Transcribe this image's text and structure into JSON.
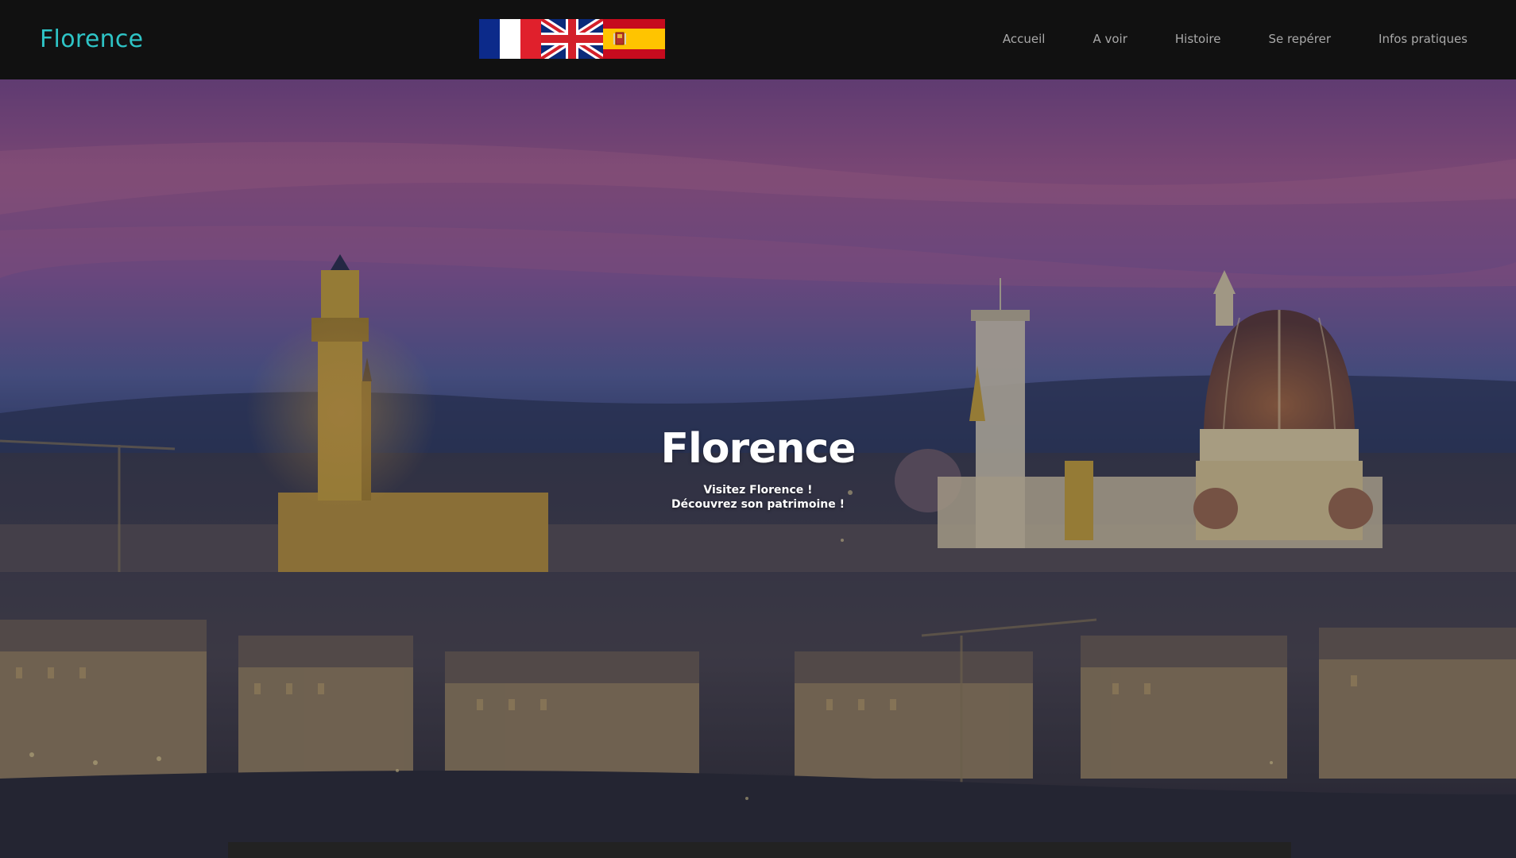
{
  "navbar": {
    "brand": "Florence",
    "flags": [
      {
        "name": "french-flag-icon",
        "lang": "fr"
      },
      {
        "name": "uk-flag-icon",
        "lang": "en"
      },
      {
        "name": "spanish-flag-icon",
        "lang": "es"
      }
    ],
    "links": [
      "Accueil",
      "A voir",
      "Histoire",
      "Se repérer",
      "Infos pratiques"
    ]
  },
  "hero": {
    "title": "Florence",
    "subtitle_line1": "Visitez Florence !",
    "subtitle_line2": "Découvrez son patrimoine !"
  },
  "colors": {
    "navbar_bg": "#111111",
    "brand": "#2ec4c6",
    "nav_link": "#a9a9a9",
    "hero_text": "#ffffff"
  }
}
